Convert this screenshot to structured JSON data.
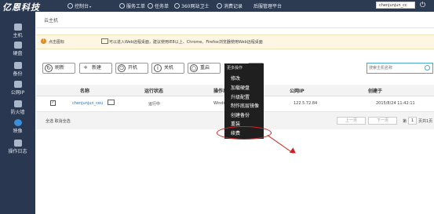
{
  "topbar": {
    "logo": "亿恩科技",
    "nav": [
      {
        "icon": "monitor-icon",
        "label": "控制台",
        "caret": "▾"
      },
      {
        "icon": "ticket-icon",
        "label": "服务工单"
      },
      {
        "icon": "task-icon",
        "label": "任务单"
      },
      {
        "icon": "shield-icon",
        "label": "360网站卫士"
      },
      {
        "icon": "record-icon",
        "label": "消费记录"
      },
      {
        "icon": "none",
        "label": "后服管理平台"
      }
    ],
    "user": "chenjunjun_cc",
    "power_icon": "⏻"
  },
  "sidebar": {
    "items": [
      {
        "icon": "host-icon",
        "label": "主机"
      },
      {
        "icon": "disk-icon",
        "label": "硬盘"
      },
      {
        "icon": "backup-icon",
        "label": "备份"
      },
      {
        "icon": "ip-icon",
        "label": "公网IP"
      },
      {
        "icon": "firewall-icon",
        "label": "防火墙"
      },
      {
        "icon": "image-icon",
        "label": "映像"
      },
      {
        "icon": "log-icon",
        "label": "操作日志"
      }
    ]
  },
  "breadcrumb": "云主机",
  "notice": {
    "part1": "点击图标",
    "part2": "可以进入Web远程桌面，建议使用IE8以上、Chrome、Firefox浏览器使用Web远程桌面"
  },
  "toolbar": {
    "refresh": "刷新",
    "new": "新建",
    "start": "开机",
    "shutdown": "关机",
    "restart": "重启",
    "more": "更多操作",
    "gear": "⚙"
  },
  "search": {
    "placeholder": "搜索主机名称"
  },
  "table": {
    "headers": [
      "名称",
      "运行状态",
      "操作系统",
      "公网IP",
      "创建于"
    ],
    "rows": [
      {
        "checked": "✓",
        "name": "chenjunjun_ceu",
        "status": "运行中",
        "os": "Window",
        "ip": "122.5.72.84",
        "created": "2015/8/24 11:42:11"
      }
    ]
  },
  "footer": {
    "select": "全选 取消全选",
    "prev": "上一页",
    "next": "下一页",
    "page_prefix": "第",
    "page": "1",
    "page_suffix": "页共1页"
  },
  "dropdown": {
    "title": "更多操作",
    "items": [
      "修改",
      "加载硬盘",
      "升级配置",
      "制作底层镜像",
      "创建备份",
      "重装",
      "续费"
    ]
  },
  "colors": {
    "topbar": "#2d3b52",
    "sidebar": "#2a3750",
    "accent": "#4aa7c9",
    "annotation": "#d02020"
  }
}
